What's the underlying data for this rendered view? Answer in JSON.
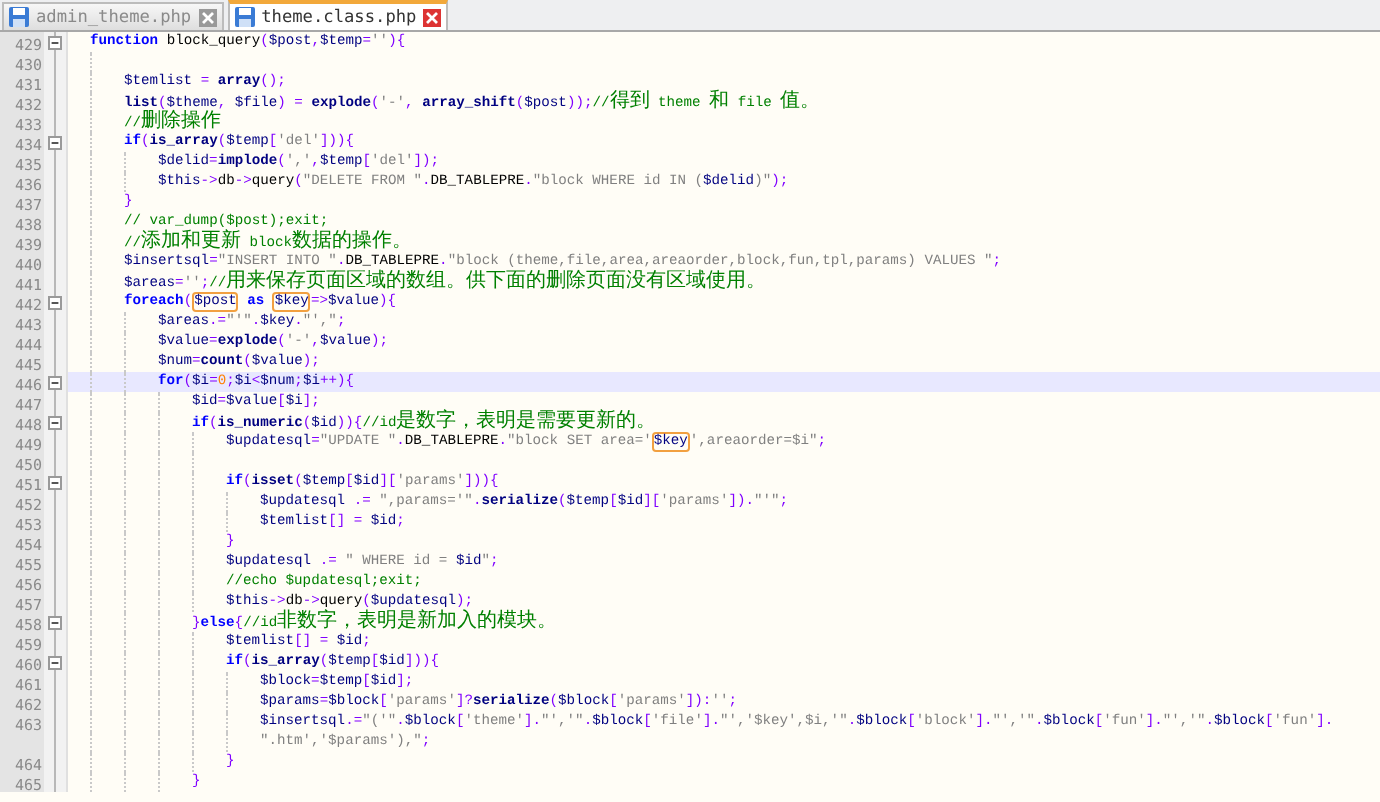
{
  "tabs": [
    {
      "label": "admin_theme.php",
      "selected": false
    },
    {
      "label": "theme.class.php",
      "selected": true
    }
  ],
  "lines": [
    {
      "number": "429",
      "current": false,
      "tokens": [
        {
          "kind": "kw",
          "text": "function"
        },
        {
          "kind": "txt",
          "text": " block_query"
        },
        {
          "kind": "op",
          "text": "("
        },
        {
          "kind": "var",
          "text": "$post"
        },
        {
          "kind": "op",
          "text": ","
        },
        {
          "kind": "var",
          "text": "$temp"
        },
        {
          "kind": "op",
          "text": "="
        },
        {
          "kind": "str",
          "text": "''"
        },
        {
          "kind": "op",
          "text": "){"
        }
      ],
      "children": [
        {
          "number": "430",
          "current": false
        },
        {
          "number": "431",
          "current": false,
          "tokens": [
            {
              "kind": "var",
              "text": "$temlist"
            },
            {
              "kind": "op",
              "text": " = "
            },
            {
              "kind": "fn",
              "text": "array"
            },
            {
              "kind": "op",
              "text": "();"
            }
          ]
        },
        {
          "number": "432",
          "current": false,
          "tokens": [
            {
              "kind": "fn",
              "text": "list"
            },
            {
              "kind": "op",
              "text": "("
            },
            {
              "kind": "var",
              "text": "$theme"
            },
            {
              "kind": "op",
              "text": ", "
            },
            {
              "kind": "var",
              "text": "$file"
            },
            {
              "kind": "op",
              "text": ") = "
            },
            {
              "kind": "fn",
              "text": "explode"
            },
            {
              "kind": "op",
              "text": "("
            },
            {
              "kind": "str",
              "text": "'-'"
            },
            {
              "kind": "op",
              "text": ", "
            },
            {
              "kind": "fn",
              "text": "array_shift"
            },
            {
              "kind": "op",
              "text": "("
            },
            {
              "kind": "var",
              "text": "$post"
            },
            {
              "kind": "op",
              "text": "));"
            },
            {
              "kind": "cmt",
              "text": "//得到 theme 和 file 值。"
            }
          ]
        },
        {
          "number": "433",
          "current": false,
          "tokens": [
            {
              "kind": "cmt",
              "text": "//删除操作"
            }
          ]
        },
        {
          "number": "434",
          "current": false,
          "tokens": [
            {
              "kind": "kw",
              "text": "if"
            },
            {
              "kind": "op",
              "text": "("
            },
            {
              "kind": "fn",
              "text": "is_array"
            },
            {
              "kind": "op",
              "text": "("
            },
            {
              "kind": "var",
              "text": "$temp"
            },
            {
              "kind": "op",
              "text": "["
            },
            {
              "kind": "str",
              "text": "'del'"
            },
            {
              "kind": "op",
              "text": "])){"
            }
          ],
          "children": [
            {
              "number": "435",
              "current": false,
              "tokens": [
                {
                  "kind": "var",
                  "text": "$delid"
                },
                {
                  "kind": "op",
                  "text": "="
                },
                {
                  "kind": "fn",
                  "text": "implode"
                },
                {
                  "kind": "op",
                  "text": "("
                },
                {
                  "kind": "str",
                  "text": "','"
                },
                {
                  "kind": "op",
                  "text": ","
                },
                {
                  "kind": "var",
                  "text": "$temp"
                },
                {
                  "kind": "op",
                  "text": "["
                },
                {
                  "kind": "str",
                  "text": "'del'"
                },
                {
                  "kind": "op",
                  "text": "]);"
                }
              ]
            },
            {
              "number": "436",
              "current": false,
              "tokens": [
                {
                  "kind": "var",
                  "text": "$this"
                },
                {
                  "kind": "op",
                  "text": "->"
                },
                {
                  "kind": "txt",
                  "text": "db"
                },
                {
                  "kind": "op",
                  "text": "->"
                },
                {
                  "kind": "txt",
                  "text": "query"
                },
                {
                  "kind": "op",
                  "text": "("
                },
                {
                  "kind": "str",
                  "text": "\"DELETE FROM \""
                },
                {
                  "kind": "op",
                  "text": "."
                },
                {
                  "kind": "txt",
                  "text": "DB_TABLEPRE"
                },
                {
                  "kind": "op",
                  "text": "."
                },
                {
                  "kind": "str",
                  "text": "\"block WHERE id IN ("
                },
                {
                  "kind": "var",
                  "text": "$delid"
                },
                {
                  "kind": "str",
                  "text": ")\""
                },
                {
                  "kind": "op",
                  "text": ");"
                }
              ]
            }
          ]
        },
        {
          "number": "437",
          "current": false,
          "tokens": [
            {
              "kind": "op",
              "text": "}"
            }
          ]
        },
        {
          "number": "438",
          "current": false,
          "tokens": [
            {
              "kind": "cmt",
              "text": "// var_dump($post);exit;"
            }
          ]
        },
        {
          "number": "439",
          "current": false,
          "tokens": [
            {
              "kind": "cmt",
              "text": "//添加和更新 block数据的操作。"
            }
          ]
        },
        {
          "number": "440",
          "current": false,
          "tokens": [
            {
              "kind": "var",
              "text": "$insertsql"
            },
            {
              "kind": "op",
              "text": "="
            },
            {
              "kind": "str",
              "text": "\"INSERT INTO \""
            },
            {
              "kind": "op",
              "text": "."
            },
            {
              "kind": "txt",
              "text": "DB_TABLEPRE"
            },
            {
              "kind": "op",
              "text": "."
            },
            {
              "kind": "str",
              "text": "\"block (theme,file,area,areaorder,block,fun,tpl,params) VALUES \""
            },
            {
              "kind": "op",
              "text": ";"
            }
          ]
        },
        {
          "number": "441",
          "current": false,
          "tokens": [
            {
              "kind": "var",
              "text": "$areas"
            },
            {
              "kind": "op",
              "text": "="
            },
            {
              "kind": "str",
              "text": "''"
            },
            {
              "kind": "op",
              "text": ";"
            },
            {
              "kind": "cmt",
              "text": "//用来保存页面区域的数组。供下面的删除页面没有区域使用。"
            }
          ]
        },
        {
          "number": "442",
          "current": false,
          "tokens": [
            {
              "kind": "kw",
              "text": "foreach"
            },
            {
              "kind": "op",
              "text": "("
            },
            {
              "kind": "var",
              "text": "$post",
              "boxed": true
            },
            {
              "kind": "kw",
              "text": " as "
            },
            {
              "kind": "var",
              "text": "$key",
              "boxed": true
            },
            {
              "kind": "op",
              "text": "=>"
            },
            {
              "kind": "var",
              "text": "$value"
            },
            {
              "kind": "op",
              "text": "){"
            }
          ],
          "children": [
            {
              "number": "443",
              "current": false,
              "tokens": [
                {
                  "kind": "var",
                  "text": "$areas"
                },
                {
                  "kind": "op",
                  "text": ".="
                },
                {
                  "kind": "str",
                  "text": "\"'\""
                },
                {
                  "kind": "op",
                  "text": "."
                },
                {
                  "kind": "var",
                  "text": "$key"
                },
                {
                  "kind": "op",
                  "text": "."
                },
                {
                  "kind": "str",
                  "text": "\"',\""
                },
                {
                  "kind": "op",
                  "text": ";"
                }
              ]
            },
            {
              "number": "444",
              "current": false,
              "tokens": [
                {
                  "kind": "var",
                  "text": "$value"
                },
                {
                  "kind": "op",
                  "text": "="
                },
                {
                  "kind": "fn",
                  "text": "explode"
                },
                {
                  "kind": "op",
                  "text": "("
                },
                {
                  "kind": "str",
                  "text": "'-'"
                },
                {
                  "kind": "op",
                  "text": ","
                },
                {
                  "kind": "var",
                  "text": "$value"
                },
                {
                  "kind": "op",
                  "text": ");"
                }
              ]
            },
            {
              "number": "445",
              "current": false,
              "tokens": [
                {
                  "kind": "var",
                  "text": "$num"
                },
                {
                  "kind": "op",
                  "text": "="
                },
                {
                  "kind": "fn",
                  "text": "count"
                },
                {
                  "kind": "op",
                  "text": "("
                },
                {
                  "kind": "var",
                  "text": "$value"
                },
                {
                  "kind": "op",
                  "text": ");"
                }
              ]
            },
            {
              "number": "446",
              "current": true,
              "tokens": [
                {
                  "kind": "kw",
                  "text": "for"
                },
                {
                  "kind": "op",
                  "text": "("
                },
                {
                  "kind": "var",
                  "text": "$i"
                },
                {
                  "kind": "op",
                  "text": "="
                },
                {
                  "kind": "num",
                  "text": "0"
                },
                {
                  "kind": "op",
                  "text": ";"
                },
                {
                  "kind": "var",
                  "text": "$i"
                },
                {
                  "kind": "op",
                  "text": "<"
                },
                {
                  "kind": "var",
                  "text": "$num"
                },
                {
                  "kind": "op",
                  "text": ";"
                },
                {
                  "kind": "var",
                  "text": "$i"
                },
                {
                  "kind": "op",
                  "text": "++){"
                }
              ],
              "children": [
                {
                  "number": "447",
                  "current": false,
                  "tokens": [
                    {
                      "kind": "var",
                      "text": "$id"
                    },
                    {
                      "kind": "op",
                      "text": "="
                    },
                    {
                      "kind": "var",
                      "text": "$value"
                    },
                    {
                      "kind": "op",
                      "text": "["
                    },
                    {
                      "kind": "var",
                      "text": "$i"
                    },
                    {
                      "kind": "op",
                      "text": "];"
                    }
                  ]
                },
                {
                  "number": "448",
                  "current": false,
                  "tokens": [
                    {
                      "kind": "kw",
                      "text": "if"
                    },
                    {
                      "kind": "op",
                      "text": "("
                    },
                    {
                      "kind": "fn",
                      "text": "is_numeric"
                    },
                    {
                      "kind": "op",
                      "text": "("
                    },
                    {
                      "kind": "var",
                      "text": "$id"
                    },
                    {
                      "kind": "op",
                      "text": ")){"
                    },
                    {
                      "kind": "cmt",
                      "text": "//id是数字，表明是需要更新的。"
                    }
                  ],
                  "children": [
                    {
                      "number": "449",
                      "current": false,
                      "tokens": [
                        {
                          "kind": "var",
                          "text": "$updatesql"
                        },
                        {
                          "kind": "op",
                          "text": "="
                        },
                        {
                          "kind": "str",
                          "text": "\"UPDATE \""
                        },
                        {
                          "kind": "op",
                          "text": "."
                        },
                        {
                          "kind": "txt",
                          "text": "DB_TABLEPRE"
                        },
                        {
                          "kind": "op",
                          "text": "."
                        },
                        {
                          "kind": "str",
                          "text": "\"block SET area='"
                        },
                        {
                          "kind": "var",
                          "text": "$key",
                          "boxed": true
                        },
                        {
                          "kind": "str",
                          "text": "',areaorder=$i\""
                        },
                        {
                          "kind": "op",
                          "text": ";"
                        }
                      ]
                    },
                    {
                      "number": "450",
                      "current": false
                    },
                    {
                      "number": "451",
                      "current": false,
                      "tokens": [
                        {
                          "kind": "kw",
                          "text": "if"
                        },
                        {
                          "kind": "op",
                          "text": "("
                        },
                        {
                          "kind": "fn",
                          "text": "isset"
                        },
                        {
                          "kind": "op",
                          "text": "("
                        },
                        {
                          "kind": "var",
                          "text": "$temp"
                        },
                        {
                          "kind": "op",
                          "text": "["
                        },
                        {
                          "kind": "var",
                          "text": "$id"
                        },
                        {
                          "kind": "op",
                          "text": "]["
                        },
                        {
                          "kind": "str",
                          "text": "'params'"
                        },
                        {
                          "kind": "op",
                          "text": "])){"
                        }
                      ],
                      "children": [
                        {
                          "number": "452",
                          "current": false,
                          "tokens": [
                            {
                              "kind": "var",
                              "text": "$updatesql"
                            },
                            {
                              "kind": "op",
                              "text": " .= "
                            },
                            {
                              "kind": "str",
                              "text": "\",params='\""
                            },
                            {
                              "kind": "op",
                              "text": "."
                            },
                            {
                              "kind": "fn",
                              "text": "serialize"
                            },
                            {
                              "kind": "op",
                              "text": "("
                            },
                            {
                              "kind": "var",
                              "text": "$temp"
                            },
                            {
                              "kind": "op",
                              "text": "["
                            },
                            {
                              "kind": "var",
                              "text": "$id"
                            },
                            {
                              "kind": "op",
                              "text": "]["
                            },
                            {
                              "kind": "str",
                              "text": "'params'"
                            },
                            {
                              "kind": "op",
                              "text": "])."
                            },
                            {
                              "kind": "str",
                              "text": "\"'\""
                            },
                            {
                              "kind": "op",
                              "text": ";"
                            }
                          ]
                        },
                        {
                          "number": "453",
                          "current": false,
                          "tokens": [
                            {
                              "kind": "var",
                              "text": "$temlist"
                            },
                            {
                              "kind": "op",
                              "text": "[] = "
                            },
                            {
                              "kind": "var",
                              "text": "$id"
                            },
                            {
                              "kind": "op",
                              "text": ";"
                            }
                          ]
                        }
                      ]
                    },
                    {
                      "number": "454",
                      "current": false,
                      "tokens": [
                        {
                          "kind": "op",
                          "text": "}"
                        }
                      ]
                    },
                    {
                      "number": "455",
                      "current": false,
                      "tokens": [
                        {
                          "kind": "var",
                          "text": "$updatesql"
                        },
                        {
                          "kind": "op",
                          "text": " .= "
                        },
                        {
                          "kind": "str",
                          "text": "\" WHERE id = "
                        },
                        {
                          "kind": "var",
                          "text": "$id"
                        },
                        {
                          "kind": "str",
                          "text": "\""
                        },
                        {
                          "kind": "op",
                          "text": ";"
                        }
                      ]
                    },
                    {
                      "number": "456",
                      "current": false,
                      "tokens": [
                        {
                          "kind": "cmt",
                          "text": "//echo $updatesql;exit;"
                        }
                      ]
                    },
                    {
                      "number": "457",
                      "current": false,
                      "tokens": [
                        {
                          "kind": "var",
                          "text": "$this"
                        },
                        {
                          "kind": "op",
                          "text": "->"
                        },
                        {
                          "kind": "txt",
                          "text": "db"
                        },
                        {
                          "kind": "op",
                          "text": "->"
                        },
                        {
                          "kind": "txt",
                          "text": "query"
                        },
                        {
                          "kind": "op",
                          "text": "("
                        },
                        {
                          "kind": "var",
                          "text": "$updatesql"
                        },
                        {
                          "kind": "op",
                          "text": ");"
                        }
                      ]
                    }
                  ]
                },
                {
                  "number": "458",
                  "current": false,
                  "tokens": [
                    {
                      "kind": "op",
                      "text": "}"
                    },
                    {
                      "kind": "kw",
                      "text": "else"
                    },
                    {
                      "kind": "op",
                      "text": "{"
                    },
                    {
                      "kind": "cmt",
                      "text": "//id非数字，表明是新加入的模块。"
                    }
                  ],
                  "children": [
                    {
                      "number": "459",
                      "current": false,
                      "tokens": [
                        {
                          "kind": "var",
                          "text": "$temlist"
                        },
                        {
                          "kind": "op",
                          "text": "[] = "
                        },
                        {
                          "kind": "var",
                          "text": "$id"
                        },
                        {
                          "kind": "op",
                          "text": ";"
                        }
                      ]
                    },
                    {
                      "number": "460",
                      "current": false,
                      "tokens": [
                        {
                          "kind": "kw",
                          "text": "if"
                        },
                        {
                          "kind": "op",
                          "text": "("
                        },
                        {
                          "kind": "fn",
                          "text": "is_array"
                        },
                        {
                          "kind": "op",
                          "text": "("
                        },
                        {
                          "kind": "var",
                          "text": "$temp"
                        },
                        {
                          "kind": "op",
                          "text": "["
                        },
                        {
                          "kind": "var",
                          "text": "$id"
                        },
                        {
                          "kind": "op",
                          "text": "])){"
                        }
                      ],
                      "children": [
                        {
                          "number": "461",
                          "current": false,
                          "tokens": [
                            {
                              "kind": "var",
                              "text": "$block"
                            },
                            {
                              "kind": "op",
                              "text": "="
                            },
                            {
                              "kind": "var",
                              "text": "$temp"
                            },
                            {
                              "kind": "op",
                              "text": "["
                            },
                            {
                              "kind": "var",
                              "text": "$id"
                            },
                            {
                              "kind": "op",
                              "text": "];"
                            }
                          ]
                        },
                        {
                          "number": "462",
                          "current": false,
                          "tokens": [
                            {
                              "kind": "var",
                              "text": "$params"
                            },
                            {
                              "kind": "op",
                              "text": "="
                            },
                            {
                              "kind": "var",
                              "text": "$block"
                            },
                            {
                              "kind": "op",
                              "text": "["
                            },
                            {
                              "kind": "str",
                              "text": "'params'"
                            },
                            {
                              "kind": "op",
                              "text": "]?"
                            },
                            {
                              "kind": "fn",
                              "text": "serialize"
                            },
                            {
                              "kind": "op",
                              "text": "("
                            },
                            {
                              "kind": "var",
                              "text": "$block"
                            },
                            {
                              "kind": "op",
                              "text": "["
                            },
                            {
                              "kind": "str",
                              "text": "'params'"
                            },
                            {
                              "kind": "op",
                              "text": "]):"
                            },
                            {
                              "kind": "str",
                              "text": "''"
                            },
                            {
                              "kind": "op",
                              "text": ";"
                            }
                          ]
                        },
                        {
                          "number": "463",
                          "current": false,
                          "tokens": [
                            {
                              "kind": "var",
                              "text": "$insertsql"
                            },
                            {
                              "kind": "op",
                              "text": ".="
                            },
                            {
                              "kind": "str",
                              "text": "\"('\""
                            },
                            {
                              "kind": "op",
                              "text": "."
                            },
                            {
                              "kind": "var",
                              "text": "$block"
                            },
                            {
                              "kind": "op",
                              "text": "["
                            },
                            {
                              "kind": "str",
                              "text": "'theme'"
                            },
                            {
                              "kind": "op",
                              "text": "]."
                            },
                            {
                              "kind": "str",
                              "text": "\"','\""
                            },
                            {
                              "kind": "op",
                              "text": "."
                            },
                            {
                              "kind": "var",
                              "text": "$block"
                            },
                            {
                              "kind": "op",
                              "text": "["
                            },
                            {
                              "kind": "str",
                              "text": "'file'"
                            },
                            {
                              "kind": "op",
                              "text": "]."
                            },
                            {
                              "kind": "str",
                              "text": "\"','$key',$i,'\""
                            },
                            {
                              "kind": "op",
                              "text": "."
                            },
                            {
                              "kind": "var",
                              "text": "$block"
                            },
                            {
                              "kind": "op",
                              "text": "["
                            },
                            {
                              "kind": "str",
                              "text": "'block'"
                            },
                            {
                              "kind": "op",
                              "text": "]."
                            },
                            {
                              "kind": "str",
                              "text": "\"','\""
                            },
                            {
                              "kind": "op",
                              "text": "."
                            },
                            {
                              "kind": "var",
                              "text": "$block"
                            },
                            {
                              "kind": "op",
                              "text": "["
                            },
                            {
                              "kind": "str",
                              "text": "'fun'"
                            },
                            {
                              "kind": "op",
                              "text": "]."
                            },
                            {
                              "kind": "str",
                              "text": "\"','\""
                            },
                            {
                              "kind": "op",
                              "text": "."
                            },
                            {
                              "kind": "var",
                              "text": "$block"
                            },
                            {
                              "kind": "op",
                              "text": "["
                            },
                            {
                              "kind": "str",
                              "text": "'fun'"
                            },
                            {
                              "kind": "op",
                              "text": "]."
                            }
                          ],
                          "continuation": [
                            {
                              "kind": "str",
                              "text": "\".htm','$params'),\""
                            },
                            {
                              "kind": "op",
                              "text": ";"
                            }
                          ]
                        }
                      ]
                    },
                    {
                      "number": "464",
                      "current": false,
                      "tokens": [
                        {
                          "kind": "op",
                          "text": "}"
                        }
                      ]
                    }
                  ]
                },
                {
                  "number": "465",
                  "current": false,
                  "tokens": [
                    {
                      "kind": "op",
                      "text": "}"
                    }
                  ]
                }
              ]
            }
          ]
        }
      ]
    }
  ]
}
